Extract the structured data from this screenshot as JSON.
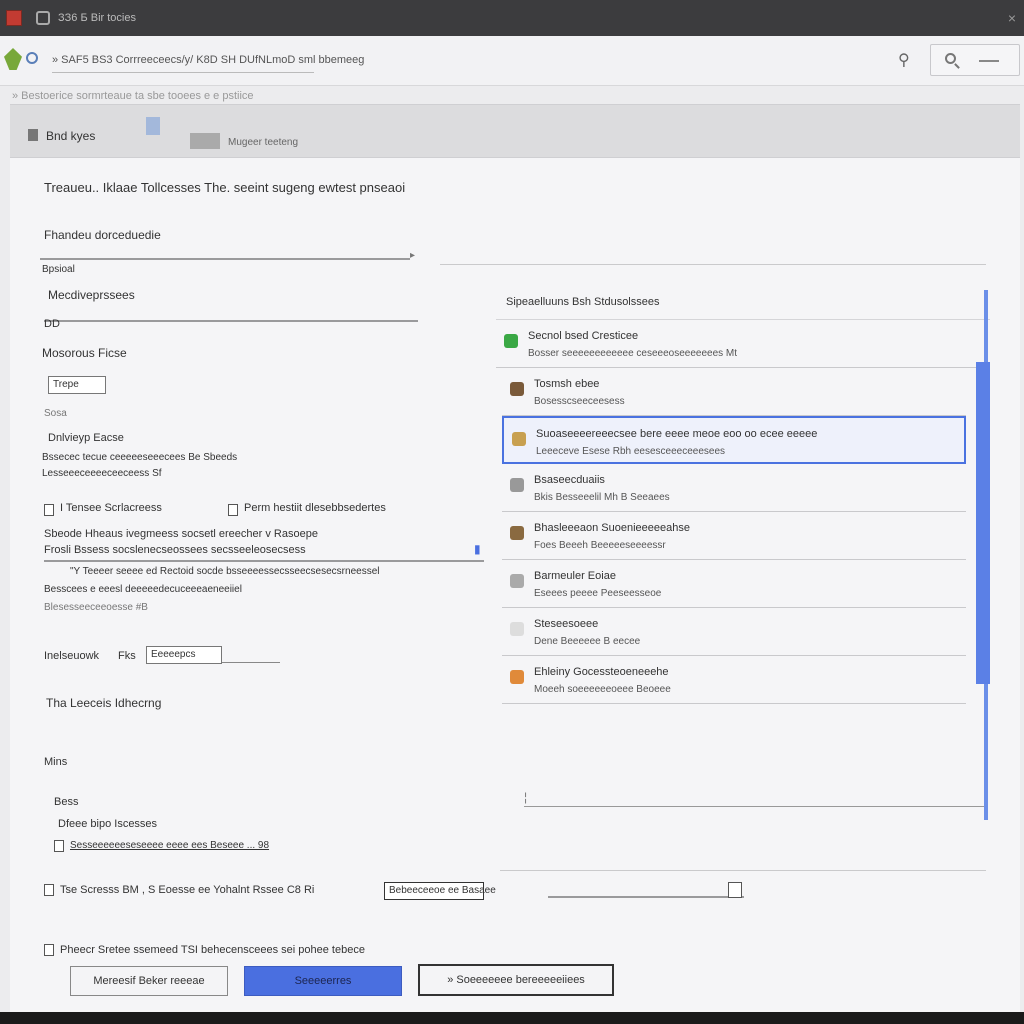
{
  "window": {
    "title": "ЗЗ6 Б Bir tocies",
    "close": "×"
  },
  "toolbar": {
    "path": "» SAF5 BS3 Corrreeceecs/y/ K8D SH DUfNLmoD sml bbemeeg",
    "pin": "⚲"
  },
  "subbar": {
    "text": "» Bestoerice sormrteaue ta sbe tooees e e pstiice"
  },
  "tabs": [
    {
      "label": "Bnd kyes"
    },
    {
      "label": "Mugeer teeteng"
    }
  ],
  "form": {
    "heading": "Treaueu.. Iklaae Tollcesses The. seeint sugeng ewtest pnseaoi",
    "field1_label": "Fhandeu dorceduedie",
    "field1_sub": "Bpsioal",
    "field2_label": "Mecdiveprssees",
    "field2_value": "DD",
    "section_label": "Mosorous Ficse",
    "input_value": "Trepe",
    "small_label": "Sosa",
    "delivery_label": "Dnlvieyp Eacse",
    "delivery_note": "Bssecec tecue ceeeeeseeecees Be Sbeeds",
    "delivery_note2": "Lesseeeceeeeceeceess Sf",
    "opt_a": "I Tensee Scrlacreess",
    "opt_b": "Perm hestiit dlesebbsedertes",
    "desc1": "Sbeode Hheaus ivegmeess socsetl ereecher v Rasoepe",
    "desc2": "Frosli Bssess socslenecseossees secsseeleosecsess",
    "desc3": "\"Y Teeeer seeee ed Rectoid socde bsseeeessecsseecsesecsrneessel",
    "desc4": "Besscees e eeesl deeeeedecuceeeaeneeiiel",
    "desc5": "Blesesseeceeoesse #B",
    "rate_label": "Inelseuowk",
    "rate_value": "Fks",
    "rate_select": "Eeeeepcs",
    "section2": "Tha Leeceis Idhecrng",
    "misc": "Mins",
    "bess": "Bess",
    "option_label": "Dfeee bipo Iscesses",
    "option_value": "Sesseeeeeeseseeee eeee ees Beseee ... 98",
    "footer_row": "Tse Scresss   BM , S Eoesse ee  Yohalnt Rssee C8   Ri",
    "footer_input": "Bebeeceeoe ee Basaee",
    "footer_checkbox": "Pheecr Sretee ssemeed TSI behecensceees sei pohee tebece"
  },
  "list": {
    "header": "Sipeaelluuns Bsh Stdusolssees",
    "items": [
      {
        "title": "Secnol bsed Cresticee",
        "sub": "Bosser seeeeeeeeeeee ceseeeoseeeeeees Mt",
        "icon_color": "#3aa845",
        "selected": false
      },
      {
        "title": "Tosmsh ebee",
        "sub": "Bosesscseeceesess",
        "icon_color": "#7a5a3a",
        "selected": false
      },
      {
        "title": "Suoaseeeereeecsee bere eeee meoe eoo oo ecee eeeee",
        "sub": "Leeeceve Esese Rbh eesesceeeceeesees",
        "icon_color": "#c8a050",
        "selected": true
      },
      {
        "title": "Bsaseecduaiis",
        "sub": "Bkis Besseeelil Mh B Seeaees",
        "icon_color": "#999999",
        "selected": false
      },
      {
        "title": "Bhasleeeaon Suoenieeeeeahse",
        "sub": "Foes Beeeh Beeeeeseeeessr",
        "icon_color": "#8a6a40",
        "selected": false
      },
      {
        "title": "Barmeuler Eoiae",
        "sub": "Eseees peeee Peeseesseoe",
        "icon_color": "#aaaaaa",
        "selected": false
      },
      {
        "title": "Steseesoeee",
        "sub": "Dene Beeeeee B eecee",
        "icon_color": "#dddddd",
        "selected": false
      },
      {
        "title": "Ehleiny Gocessteoeneeehe",
        "sub": "Moeeh soeeeeeeoeee Beoeee",
        "icon_color": "#e08a3a",
        "selected": false
      }
    ]
  },
  "buttons": {
    "cancel": "Mereesif Beker reeeae",
    "primary": "Seeeeerres",
    "secondary": "» Soeeeeeee bereeeeeiiees"
  },
  "colors": {
    "accent": "#4a6fe0",
    "titlebar": "#3c3c3e",
    "background": "#f5f5f7"
  }
}
